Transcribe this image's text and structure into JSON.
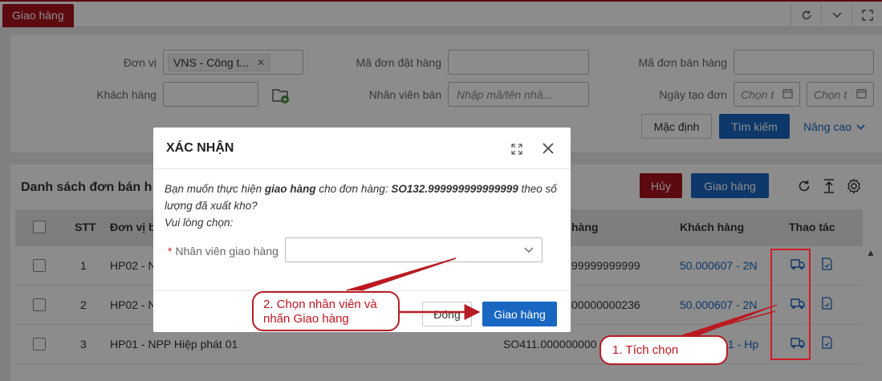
{
  "topbar": {
    "tab_label": "Giao hàng"
  },
  "filter": {
    "don_vi_label": "Đơn vị",
    "don_vi_chip": "VNS - Công t...",
    "ma_don_dat_label": "Mã đơn đặt hàng",
    "ma_don_ban_label": "Mã đơn bán hàng",
    "khach_hang_label": "Khách hàng",
    "nhan_vien_ban_label": "Nhân viên bán",
    "nhan_vien_ban_placeholder": "Nhập mã/tên nhâ...",
    "ngay_tao_label": "Ngày tạo đơn",
    "date_from_placeholder": "Chọn t",
    "date_to_placeholder": "Chọn t",
    "btn_default": "Mặc định",
    "btn_search": "Tìm kiếm",
    "btn_advanced": "Nâng cao"
  },
  "list": {
    "title": "Danh sách đơn bán h",
    "btn_cancel": "Hủy",
    "btn_deliver": "Giao hàng",
    "columns": {
      "stt": "STT",
      "don_vi": "Đơn vị b",
      "ma_don": "hàng",
      "khach_hang": "Khách hàng",
      "thao_tac": "Thao tác"
    },
    "rows": [
      {
        "stt": "1",
        "don_vi": "HP02 - N",
        "ma_don": "99999999999",
        "khach_hang": "50.000607 - 2N"
      },
      {
        "stt": "2",
        "don_vi": "HP02 - N",
        "ma_don": "00000000236",
        "khach_hang": "50.000607 - 2N"
      },
      {
        "stt": "3",
        "don_vi": "HP01 - NPP Hiệp phát 01",
        "ma_don": "SO411.000000000",
        "khach_hang": "1 - Hp"
      }
    ]
  },
  "modal": {
    "title": "XÁC NHẬN",
    "msg_pre": "Bạn muốn thực hiện ",
    "msg_action": "giao hàng",
    "msg_mid": " cho đơn hàng: ",
    "msg_order": "SO132.999999999999999",
    "msg_post": " theo số lượng đã xuất kho?",
    "msg_choose": "Vui lòng chọn:",
    "field_label": "Nhân viên giao hàng",
    "btn_close": "Đóng",
    "btn_confirm": "Giao hàng"
  },
  "annotations": {
    "step1": "1. Tích chọn",
    "step2_line1": "2. Chọn nhân viên và",
    "step2_line2": "nhấn Giao hàng"
  },
  "colors": {
    "brand_red": "#a8121c",
    "primary_blue": "#1a67c2",
    "annotation_red": "#c0161f"
  }
}
